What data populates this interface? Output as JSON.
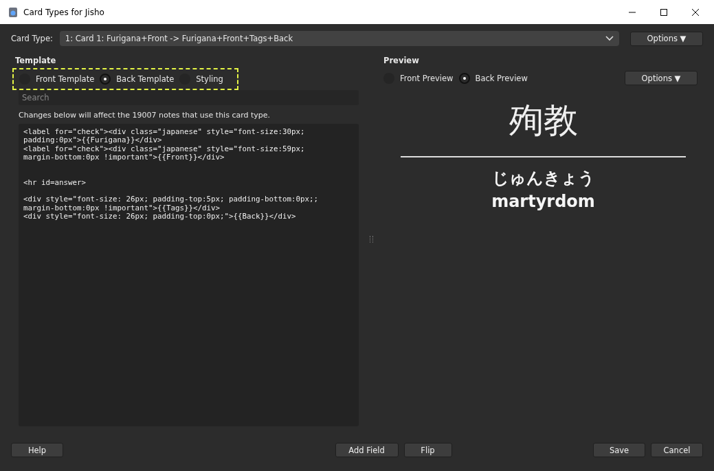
{
  "window": {
    "title": "Card Types for Jisho"
  },
  "card_type": {
    "label": "Card Type:",
    "value": "1: Card 1: Furigana+Front -> Furigana+Front+Tags+Back",
    "options_button": "Options ▼"
  },
  "template": {
    "heading": "Template",
    "radios": [
      {
        "label": "Front Template",
        "selected": false
      },
      {
        "label": "Back Template",
        "selected": true
      },
      {
        "label": "Styling",
        "selected": false
      }
    ],
    "search": {
      "placeholder": "Search"
    },
    "notice": "Changes below will affect the 19007 notes that use this card type.",
    "code": "<label for=\"check\"><div class=\"japanese\" style=\"font-size:30px;\npadding:0px\">{{Furigana}}</div>\n<label for=\"check\"><div class=\"japanese\" style=\"font-size:59px;\nmargin-bottom:0px !important\">{{Front}}</div>\n\n\n<hr id=answer>\n\n<div style=\"font-size: 26px; padding-top:5px; padding-bottom:0px;;\nmargin-bottom:0px !important\">{{Tags}}</div>\n<div style=\"font-size: 26px; padding-top:0px;\">{{Back}}</div>"
  },
  "preview": {
    "heading": "Preview",
    "radios": [
      {
        "label": "Front Preview",
        "selected": false
      },
      {
        "label": "Back Preview",
        "selected": true
      }
    ],
    "options_button": "Options ▼",
    "card": {
      "front": "殉教",
      "furigana": "じゅんきょう",
      "back": "martyrdom"
    }
  },
  "buttons": {
    "left": [
      "Help"
    ],
    "center": [
      "Add Field",
      "Flip"
    ],
    "right": [
      "Save",
      "Cancel"
    ]
  }
}
